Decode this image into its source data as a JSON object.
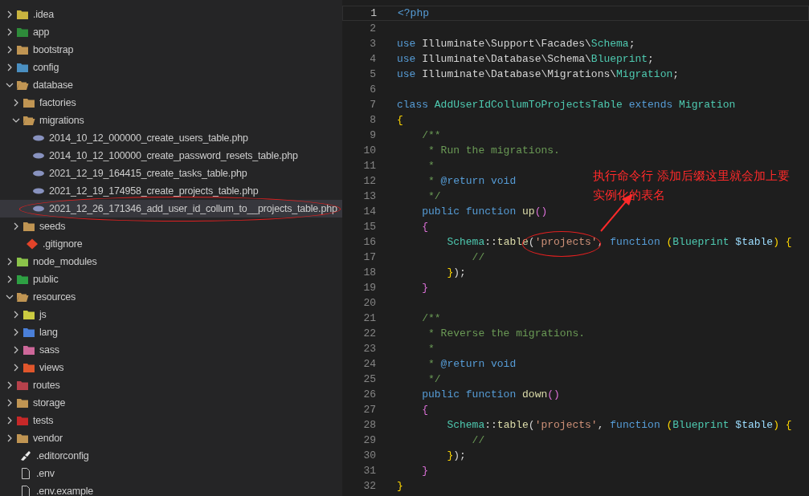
{
  "explorer": {
    "items": [
      {
        "label": ".idea",
        "kind": "idea",
        "expanded": false,
        "selected": false
      },
      {
        "label": "app",
        "kind": "app",
        "expanded": false,
        "selected": false
      },
      {
        "label": "bootstrap",
        "kind": "folder",
        "expanded": false,
        "selected": false
      },
      {
        "label": "config",
        "kind": "config",
        "expanded": false,
        "selected": false
      },
      {
        "label": "database",
        "kind": "database",
        "expanded": true,
        "selected": false,
        "children": [
          {
            "label": "factories",
            "kind": "folder",
            "expanded": false,
            "selected": false
          },
          {
            "label": "migrations",
            "kind": "folder",
            "expanded": true,
            "selected": false,
            "children": [
              {
                "label": "2014_10_12_000000_create_users_table.php",
                "kind": "php",
                "selected": false
              },
              {
                "label": "2014_10_12_100000_create_password_resets_table.php",
                "kind": "php",
                "selected": false
              },
              {
                "label": "2021_12_19_164415_create_tasks_table.php",
                "kind": "php",
                "selected": false
              },
              {
                "label": "2021_12_19_174958_create_projects_table.php",
                "kind": "php",
                "selected": false
              },
              {
                "label": "2021_12_26_171346_add_user_id_collum_to__projects_table.php",
                "kind": "php",
                "selected": true
              }
            ]
          },
          {
            "label": "seeds",
            "kind": "folder",
            "expanded": false,
            "selected": false
          },
          {
            "label": ".gitignore",
            "kind": "git",
            "selected": false
          }
        ]
      },
      {
        "label": "node_modules",
        "kind": "node",
        "expanded": false,
        "selected": false
      },
      {
        "label": "public",
        "kind": "public",
        "expanded": false,
        "selected": false
      },
      {
        "label": "resources",
        "kind": "folder",
        "expanded": true,
        "selected": false,
        "children": [
          {
            "label": "js",
            "kind": "js",
            "expanded": false,
            "selected": false
          },
          {
            "label": "lang",
            "kind": "lang",
            "expanded": false,
            "selected": false
          },
          {
            "label": "sass",
            "kind": "sass",
            "expanded": false,
            "selected": false
          },
          {
            "label": "views",
            "kind": "views",
            "expanded": false,
            "selected": false
          }
        ]
      },
      {
        "label": "routes",
        "kind": "routes",
        "expanded": false,
        "selected": false
      },
      {
        "label": "storage",
        "kind": "folder",
        "expanded": false,
        "selected": false
      },
      {
        "label": "tests",
        "kind": "tests",
        "expanded": false,
        "selected": false
      },
      {
        "label": "vendor",
        "kind": "folder",
        "expanded": false,
        "selected": false
      },
      {
        "label": ".editorconfig",
        "kind": "editorconfig",
        "selected": false
      },
      {
        "label": ".env",
        "kind": "file",
        "selected": false
      },
      {
        "label": ".env.example",
        "kind": "file",
        "selected": false
      }
    ]
  },
  "editor": {
    "lines": [
      {
        "number": "1",
        "current": true,
        "tokens": [
          {
            "kind": "kw",
            "text": "<?php"
          }
        ]
      },
      {
        "number": "2",
        "current": false
      },
      {
        "number": "3",
        "current": false,
        "tokens": [
          {
            "kind": "kw",
            "text": "use "
          },
          {
            "kind": "plain",
            "text": "Illuminate\\Support\\Facades\\"
          },
          {
            "kind": "cls",
            "text": "Schema"
          },
          {
            "kind": "plain",
            "text": ";"
          }
        ]
      },
      {
        "number": "4",
        "current": false,
        "tokens": [
          {
            "kind": "kw",
            "text": "use "
          },
          {
            "kind": "plain",
            "text": "Illuminate\\Database\\Schema\\"
          },
          {
            "kind": "cls",
            "text": "Blueprint"
          },
          {
            "kind": "plain",
            "text": ";"
          }
        ]
      },
      {
        "number": "5",
        "current": false,
        "tokens": [
          {
            "kind": "kw",
            "text": "use "
          },
          {
            "kind": "plain",
            "text": "Illuminate\\Database\\Migrations\\"
          },
          {
            "kind": "cls",
            "text": "Migration"
          },
          {
            "kind": "plain",
            "text": ";"
          }
        ]
      },
      {
        "number": "6",
        "current": false
      },
      {
        "number": "7",
        "current": false,
        "tokens": [
          {
            "kind": "kw",
            "text": "class "
          },
          {
            "kind": "cls",
            "text": "AddUserIdCollumToProjectsTable"
          },
          {
            "kind": "kw",
            "text": " extends "
          },
          {
            "kind": "cls",
            "text": "Migration"
          }
        ]
      },
      {
        "number": "8",
        "current": false,
        "tokens": [
          {
            "kind": "brace1",
            "text": "{"
          }
        ]
      },
      {
        "number": "9",
        "current": false,
        "tokens": [
          {
            "kind": "comment",
            "text": "    /**"
          }
        ]
      },
      {
        "number": "10",
        "current": false,
        "tokens": [
          {
            "kind": "comment",
            "text": "     * Run the migrations."
          }
        ]
      },
      {
        "number": "11",
        "current": false,
        "tokens": [
          {
            "kind": "comment",
            "text": "     *"
          }
        ]
      },
      {
        "number": "12",
        "current": false,
        "tokens": [
          {
            "kind": "comment",
            "text": "     * "
          },
          {
            "kind": "kw",
            "text": "@return void"
          }
        ]
      },
      {
        "number": "13",
        "current": false,
        "tokens": [
          {
            "kind": "comment",
            "text": "     */"
          }
        ]
      },
      {
        "number": "14",
        "current": false,
        "tokens": [
          {
            "kind": "kw",
            "text": "    public function "
          },
          {
            "kind": "fn",
            "text": "up"
          },
          {
            "kind": "brace2",
            "text": "()"
          }
        ]
      },
      {
        "number": "15",
        "current": false,
        "tokens": [
          {
            "kind": "brace2",
            "text": "    {"
          }
        ]
      },
      {
        "number": "16",
        "current": false,
        "tokens": [
          {
            "kind": "cls",
            "text": "        Schema"
          },
          {
            "kind": "plain",
            "text": "::"
          },
          {
            "kind": "fn",
            "text": "table"
          },
          {
            "kind": "brace3",
            "text": "("
          },
          {
            "kind": "str",
            "text": "'projects'"
          },
          {
            "kind": "plain",
            "text": ", "
          },
          {
            "kind": "kw",
            "text": "function "
          },
          {
            "kind": "brace1",
            "text": "("
          },
          {
            "kind": "cls",
            "text": "Blueprint "
          },
          {
            "kind": "var",
            "text": "$table"
          },
          {
            "kind": "brace1",
            "text": ") {"
          }
        ]
      },
      {
        "number": "17",
        "current": false,
        "tokens": [
          {
            "kind": "comment",
            "text": "            //"
          }
        ]
      },
      {
        "number": "18",
        "current": false,
        "tokens": [
          {
            "kind": "brace1",
            "text": "        }"
          },
          {
            "kind": "brace3",
            "text": ")"
          },
          {
            "kind": "plain",
            "text": ";"
          }
        ]
      },
      {
        "number": "19",
        "current": false,
        "tokens": [
          {
            "kind": "brace2",
            "text": "    }"
          }
        ]
      },
      {
        "number": "20",
        "current": false
      },
      {
        "number": "21",
        "current": false,
        "tokens": [
          {
            "kind": "comment",
            "text": "    /**"
          }
        ]
      },
      {
        "number": "22",
        "current": false,
        "tokens": [
          {
            "kind": "comment",
            "text": "     * Reverse the migrations."
          }
        ]
      },
      {
        "number": "23",
        "current": false,
        "tokens": [
          {
            "kind": "comment",
            "text": "     *"
          }
        ]
      },
      {
        "number": "24",
        "current": false,
        "tokens": [
          {
            "kind": "comment",
            "text": "     * "
          },
          {
            "kind": "kw",
            "text": "@return void"
          }
        ]
      },
      {
        "number": "25",
        "current": false,
        "tokens": [
          {
            "kind": "comment",
            "text": "     */"
          }
        ]
      },
      {
        "number": "26",
        "current": false,
        "tokens": [
          {
            "kind": "kw",
            "text": "    public function "
          },
          {
            "kind": "fn",
            "text": "down"
          },
          {
            "kind": "brace2",
            "text": "()"
          }
        ]
      },
      {
        "number": "27",
        "current": false,
        "tokens": [
          {
            "kind": "brace2",
            "text": "    {"
          }
        ]
      },
      {
        "number": "28",
        "current": false,
        "tokens": [
          {
            "kind": "cls",
            "text": "        Schema"
          },
          {
            "kind": "plain",
            "text": "::"
          },
          {
            "kind": "fn",
            "text": "table"
          },
          {
            "kind": "brace3",
            "text": "("
          },
          {
            "kind": "str",
            "text": "'projects'"
          },
          {
            "kind": "plain",
            "text": ", "
          },
          {
            "kind": "kw",
            "text": "function "
          },
          {
            "kind": "brace1",
            "text": "("
          },
          {
            "kind": "cls",
            "text": "Blueprint "
          },
          {
            "kind": "var",
            "text": "$table"
          },
          {
            "kind": "brace1",
            "text": ") {"
          }
        ]
      },
      {
        "number": "29",
        "current": false,
        "tokens": [
          {
            "kind": "comment",
            "text": "            //"
          }
        ]
      },
      {
        "number": "30",
        "current": false,
        "tokens": [
          {
            "kind": "brace1",
            "text": "        }"
          },
          {
            "kind": "brace3",
            "text": ")"
          },
          {
            "kind": "plain",
            "text": ";"
          }
        ]
      },
      {
        "number": "31",
        "current": false,
        "tokens": [
          {
            "kind": "brace2",
            "text": "    }"
          }
        ]
      },
      {
        "number": "32",
        "current": false,
        "tokens": [
          {
            "kind": "brace1",
            "text": "}"
          }
        ]
      }
    ]
  },
  "annotation": {
    "lines": [
      "执行命令行 添加后缀这里就会加上要",
      "实例化的表名"
    ]
  }
}
